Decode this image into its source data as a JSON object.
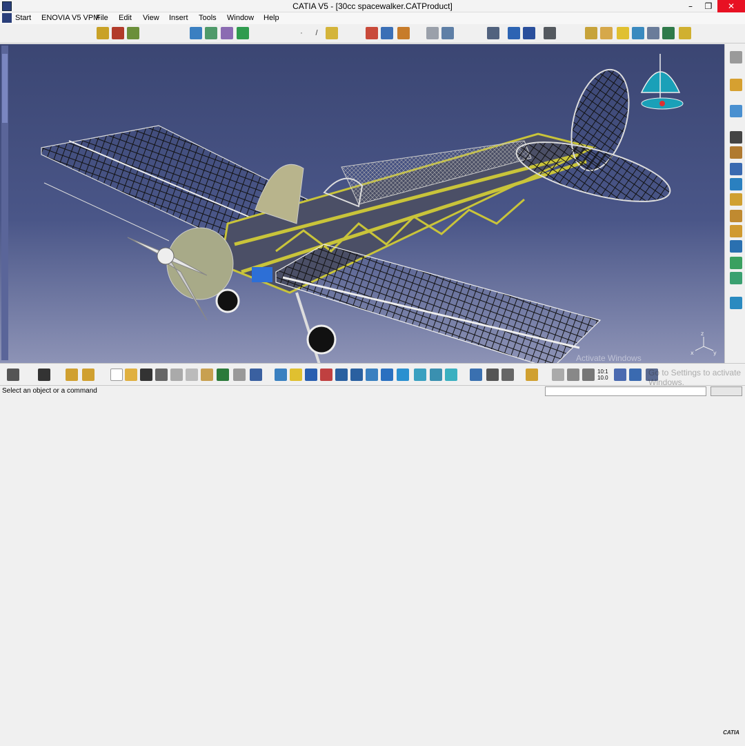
{
  "window": {
    "title": "CATIA V5 - [30cc spacewalker.CATProduct]"
  },
  "menu": {
    "items": [
      {
        "label": "Start"
      },
      {
        "label": "ENOVIA V5 VPM"
      },
      {
        "label": "File"
      },
      {
        "label": "Edit"
      },
      {
        "label": "View"
      },
      {
        "label": "Insert"
      },
      {
        "label": "Tools"
      },
      {
        "label": "Window"
      },
      {
        "label": "Help"
      }
    ]
  },
  "viewport": {
    "compass_axes": [
      "x",
      "y",
      "z"
    ],
    "watermark_line1": "Activate Windows",
    "watermark_line2": "Go to Settings to activate Windows."
  },
  "bottombar": {
    "zoom_top": "10:1",
    "zoom_bottom": "10.0",
    "brand": "CATIA"
  },
  "status": {
    "message": "Select an object or a command"
  },
  "colors": {
    "viewport_top": "#3b4673",
    "viewport_bottom": "#8d93b6",
    "frame_yellow": "#c9c43a",
    "close_red": "#e81123"
  }
}
